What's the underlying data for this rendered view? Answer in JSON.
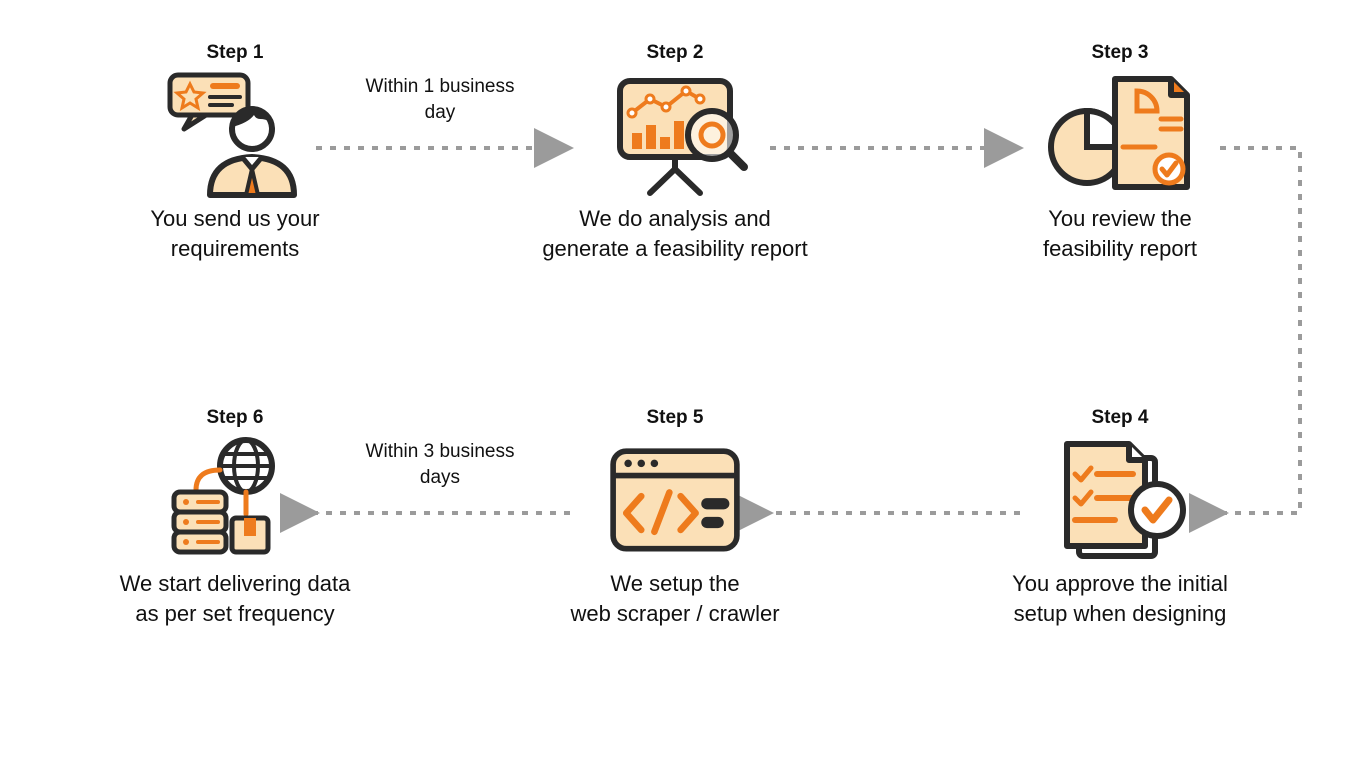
{
  "steps": [
    {
      "title": "Step 1",
      "desc_line1": "You send us your",
      "desc_line2": "requirements"
    },
    {
      "title": "Step 2",
      "desc_line1": "We do analysis and",
      "desc_line2": "generate a feasibility report"
    },
    {
      "title": "Step 3",
      "desc_line1": "You review the",
      "desc_line2": "feasibility report"
    },
    {
      "title": "Step 4",
      "desc_line1": "You approve the initial",
      "desc_line2": "setup when designing"
    },
    {
      "title": "Step 5",
      "desc_line1": "We setup the",
      "desc_line2": "web scraper / crawler"
    },
    {
      "title": "Step 6",
      "desc_line1": "We start delivering data",
      "desc_line2": "as per set frequency"
    }
  ],
  "connectors": {
    "c1_line1": "Within 1 business",
    "c1_line2": "day",
    "c5_line1": "Within 3 business",
    "c5_line2": "days"
  }
}
